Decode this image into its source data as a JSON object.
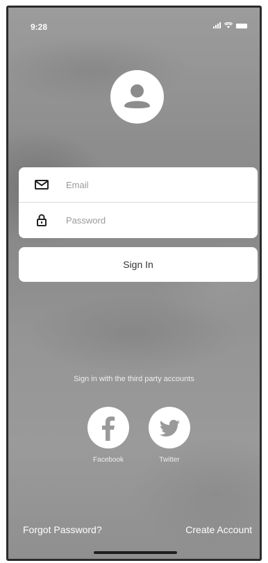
{
  "status_bar": {
    "time": "9:28",
    "icons": [
      "signal-icon",
      "wifi-icon",
      "battery-icon"
    ]
  },
  "avatar": {
    "icon": "user-icon"
  },
  "login": {
    "email_placeholder": "Email",
    "email_value": "",
    "email_icon": "mail-icon",
    "password_placeholder": "Password",
    "password_value": "",
    "password_icon": "lock-icon"
  },
  "signin_label": "Sign In",
  "third_party": {
    "text": "Sign in with the third party accounts",
    "facebook_label": "Facebook",
    "twitter_label": "Twitter"
  },
  "footer": {
    "forgot_password": "Forgot Password?",
    "create_account": "Create Account"
  },
  "colors": {
    "card": "#ffffff",
    "background": "#8f8f8f",
    "text_on_bg": "#ffffff"
  }
}
